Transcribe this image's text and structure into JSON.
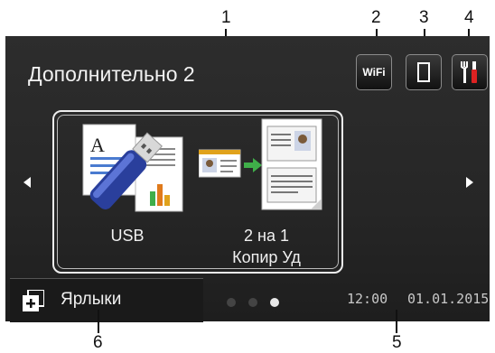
{
  "callouts": {
    "c1": "1",
    "c2": "2",
    "c3": "3",
    "c4": "4",
    "c5": "5",
    "c6": "6"
  },
  "screen": {
    "title": "Дополнительно 2",
    "wifi_label": "WiFi",
    "apps": [
      {
        "label_line1": "USB",
        "label_line2": "",
        "icon": "usb-drive-icon"
      },
      {
        "label_line1": "2 на 1",
        "label_line2": "Копир Уд",
        "icon": "id-copy-icon"
      }
    ],
    "shortcuts_label": "Ярлыки",
    "time": "12:00",
    "date": "01.01.2015",
    "page_indicator": {
      "count": 3,
      "active": 3
    }
  },
  "colors": {
    "screen_bg": "#262626",
    "accent_green": "#3fae49",
    "usb_blue": "#2a3f9c"
  }
}
